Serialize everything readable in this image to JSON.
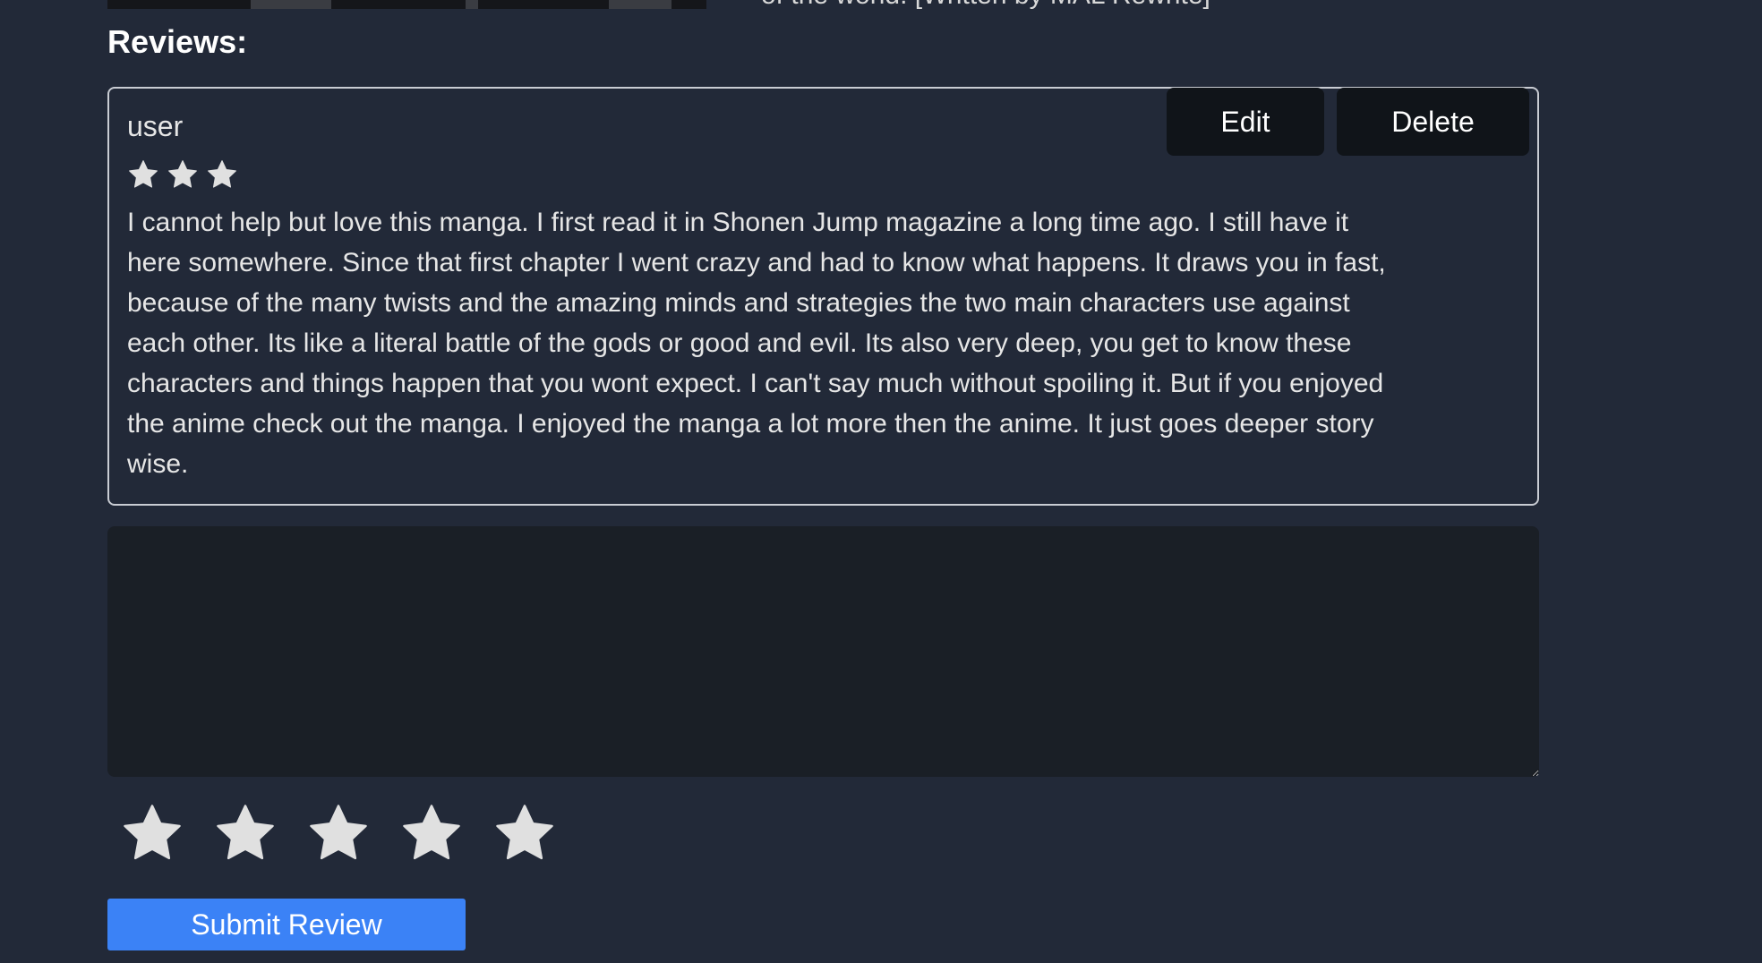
{
  "product": {
    "description_tail": "of the world. [Written by MAL Rewrite]"
  },
  "reviews": {
    "heading": "Reviews:",
    "items": [
      {
        "username": "user",
        "rating": 3,
        "text": "I cannot help but love this manga. I first read it in Shonen Jump magazine a long time ago. I still have it here somewhere. Since that first chapter I went crazy and had to know what happens. It draws you in fast, because of the many twists and the amazing minds and strategies the two main characters use against each other. Its like a literal battle of the gods or good and evil. Its also very deep, you get to know these characters and things happen that you wont expect. I can't say much without spoiling it. But if you enjoyed the anime check out the manga. I enjoyed the manga a lot more then the anime. It just goes deeper story wise.",
        "edit_label": "Edit",
        "delete_label": "Delete"
      }
    ]
  },
  "review_form": {
    "textarea_value": "",
    "rating_max": 5,
    "star_icon": "star-icon",
    "submit_label": "Submit Review"
  },
  "colors": {
    "background": "#222938",
    "accent": "#3b82f6",
    "star": "#e0e0e0",
    "button_dark": "#101419"
  }
}
